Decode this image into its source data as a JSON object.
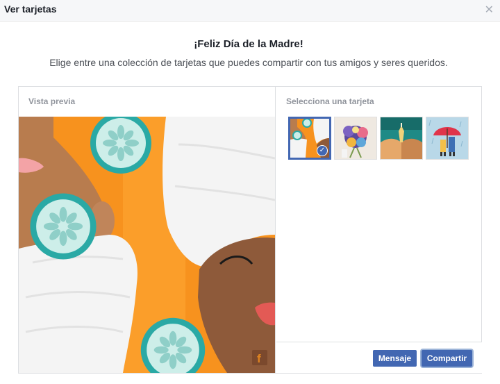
{
  "window": {
    "title": "Ver tarjetas",
    "close_icon": "close-icon"
  },
  "header": {
    "title": "¡Feliz Día de la Madre!",
    "subtitle": "Elige entre una colección de tarjetas que puedes compartir con tus amigos y seres queridos."
  },
  "preview": {
    "label": "Vista previa"
  },
  "selection": {
    "label": "Selecciona una tarjeta",
    "cards": [
      {
        "name": "spa-card",
        "selected": true
      },
      {
        "name": "flowers-card",
        "selected": false
      },
      {
        "name": "hands-card",
        "selected": false
      },
      {
        "name": "umbrella-card",
        "selected": false
      }
    ]
  },
  "actions": {
    "message_label": "Mensaje",
    "share_label": "Compartir"
  },
  "colors": {
    "accent": "#4267b2",
    "orange": "#f7921e",
    "teal": "#2aa9a5"
  }
}
